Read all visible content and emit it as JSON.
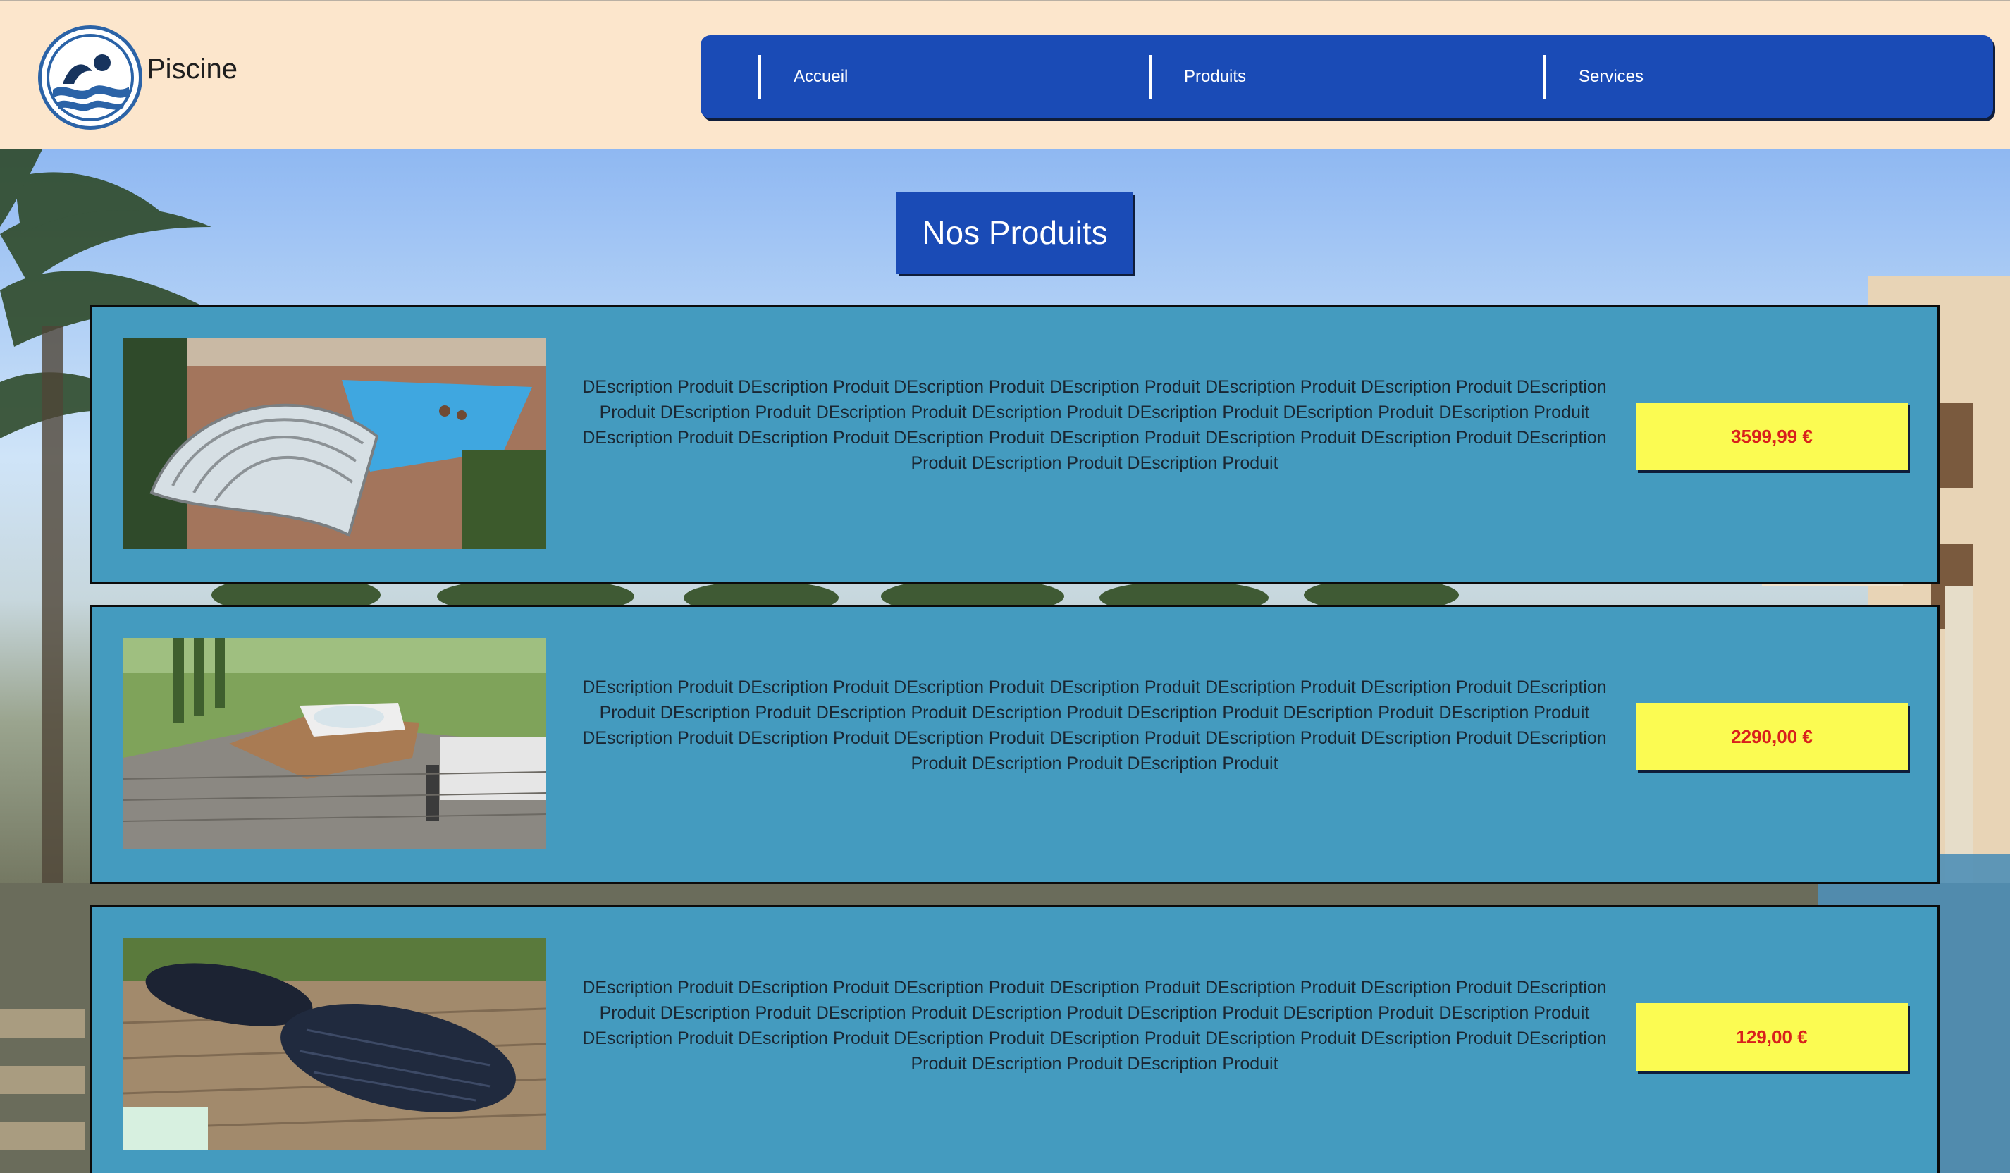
{
  "header": {
    "brand": "Piscine",
    "logo_icon": "swimmer-wave-icon",
    "nav": [
      {
        "label": "Accueil"
      },
      {
        "label": "Produits"
      },
      {
        "label": "Services"
      }
    ]
  },
  "main": {
    "title": "Nos Produits",
    "products": [
      {
        "image_icon": "pool-enclosure-photo",
        "description": "DEscription Produit DEscription Produit DEscription Produit DEscription Produit DEscription Produit DEscription Produit DEscription Produit DEscription Produit DEscription Produit DEscription Produit DEscription Produit DEscription Produit DEscription Produit DEscription Produit DEscription Produit DEscription Produit DEscription Produit DEscription Produit DEscription Produit DEscription Produit DEscription Produit DEscription Produit",
        "price": "3599,99 €"
      },
      {
        "image_icon": "hot-tub-deck-photo",
        "description": "DEscription Produit DEscription Produit DEscription Produit DEscription Produit DEscription Produit DEscription Produit DEscription Produit DEscription Produit DEscription Produit DEscription Produit DEscription Produit DEscription Produit DEscription Produit DEscription Produit DEscription Produit DEscription Produit DEscription Produit DEscription Produit DEscription Produit DEscription Produit DEscription Produit DEscription Produit",
        "price": "2290,00 €"
      },
      {
        "image_icon": "solar-pool-heater-photo",
        "description": "DEscription Produit DEscription Produit DEscription Produit DEscription Produit DEscription Produit DEscription Produit DEscription Produit DEscription Produit DEscription Produit DEscription Produit DEscription Produit DEscription Produit DEscription Produit DEscription Produit DEscription Produit DEscription Produit DEscription Produit DEscription Produit DEscription Produit DEscription Produit DEscription Produit DEscription Produit",
        "price": "129,00 €"
      }
    ]
  },
  "colors": {
    "header_bg": "#fce6cc",
    "nav_bg": "#1a4bb6",
    "card_bg": "#449bbf",
    "price_bg": "#fbfb52",
    "price_text": "#d8201c"
  }
}
